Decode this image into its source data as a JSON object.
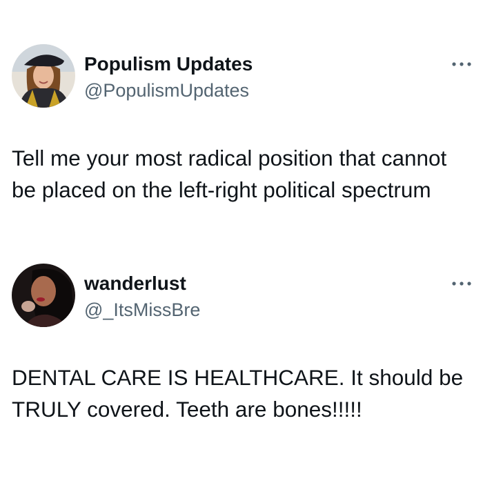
{
  "posts": [
    {
      "display_name": "Populism Updates",
      "handle": "@PopulismUpdates",
      "avatar_icon": "woman-in-beret-avatar",
      "menu_icon": "more-dots-icon",
      "text": "Tell me your most radical position that cannot be placed on the left-right political spectrum"
    },
    {
      "display_name": "wanderlust",
      "handle": "@_ItsMissBre",
      "avatar_icon": "woman-selfie-avatar",
      "menu_icon": "more-dots-icon",
      "text": "DENTAL CARE IS HEALTHCARE. It should be TRULY covered. Teeth are bones!!!!!"
    }
  ],
  "colors": {
    "text_primary": "#0f1419",
    "text_secondary": "#536471",
    "background": "#ffffff"
  }
}
